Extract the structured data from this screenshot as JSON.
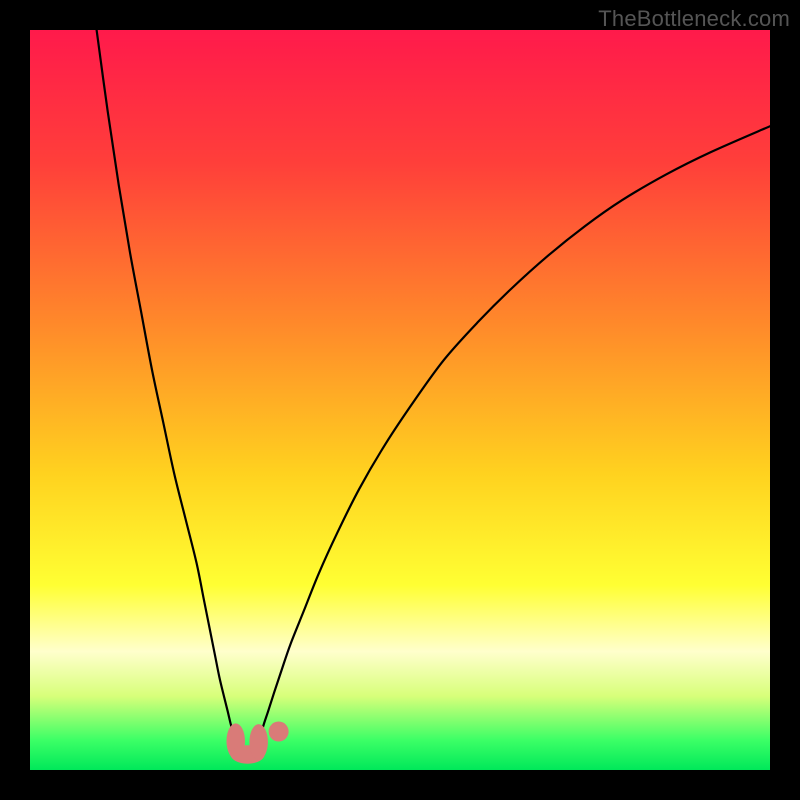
{
  "watermark": "TheBottleneck.com",
  "chart_data": {
    "type": "line",
    "title": "",
    "xlabel": "",
    "ylabel": "",
    "xlim": [
      0,
      100
    ],
    "ylim": [
      0,
      100
    ],
    "gradient_stops": [
      {
        "offset": 0,
        "color": "#ff1a4b"
      },
      {
        "offset": 18,
        "color": "#ff3f3a"
      },
      {
        "offset": 40,
        "color": "#ff8a2a"
      },
      {
        "offset": 60,
        "color": "#ffd21f"
      },
      {
        "offset": 75,
        "color": "#ffff33"
      },
      {
        "offset": 80,
        "color": "#ffff88"
      },
      {
        "offset": 84,
        "color": "#ffffcc"
      },
      {
        "offset": 90,
        "color": "#d8ff7a"
      },
      {
        "offset": 96,
        "color": "#3bff66"
      },
      {
        "offset": 100,
        "color": "#00e85a"
      }
    ],
    "series": [
      {
        "name": "left-curve",
        "stroke": "#000000",
        "width": 2.2,
        "x": [
          9,
          10.5,
          12,
          13.5,
          15,
          16.5,
          18,
          19.5,
          21,
          22.5,
          23.5,
          24.3,
          25,
          25.6,
          26.2,
          26.7,
          27.1,
          27.4,
          27.7
        ],
        "y": [
          100,
          89,
          79,
          70,
          62,
          54,
          47,
          40,
          34,
          28,
          23,
          19,
          15.5,
          12.5,
          10,
          8,
          6.3,
          5.2,
          4.3
        ]
      },
      {
        "name": "right-curve",
        "stroke": "#000000",
        "width": 2.2,
        "x": [
          31.2,
          31.6,
          32.2,
          33,
          34,
          35.2,
          37,
          39,
          41.5,
          44.5,
          48,
          52,
          56,
          60.5,
          65,
          70,
          75,
          80,
          86,
          92,
          100
        ],
        "y": [
          4.8,
          6.2,
          8,
          10.5,
          13.5,
          17,
          21.5,
          26.5,
          32,
          38,
          44,
          50,
          55.5,
          60.5,
          65,
          69.5,
          73.5,
          77,
          80.5,
          83.5,
          87
        ]
      }
    ],
    "blobs": [
      {
        "name": "U-left",
        "cx": 27.8,
        "cy": 3.9,
        "rx": 1.25,
        "ry": 2.4,
        "fill": "#d97b78"
      },
      {
        "name": "U-bottom",
        "cx": 29.4,
        "cy": 2.1,
        "rx": 2.3,
        "ry": 1.25,
        "fill": "#d97b78"
      },
      {
        "name": "U-right",
        "cx": 30.9,
        "cy": 3.8,
        "rx": 1.25,
        "ry": 2.4,
        "fill": "#d97b78"
      },
      {
        "name": "dot",
        "cx": 33.6,
        "cy": 5.2,
        "rx": 1.35,
        "ry": 1.35,
        "fill": "#d97b78"
      }
    ]
  }
}
